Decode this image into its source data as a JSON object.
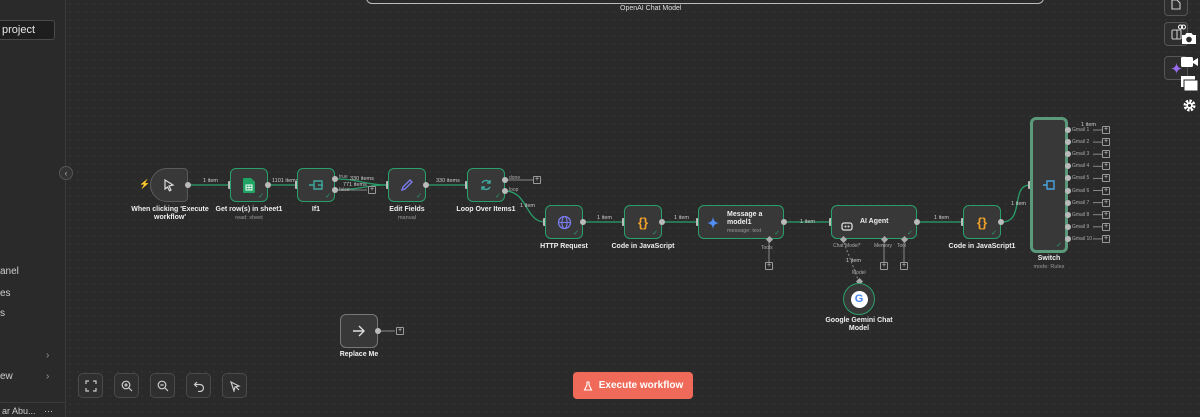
{
  "sidebar": {
    "project": "project",
    "items": [
      "anel",
      "es",
      "s",
      "",
      "ew"
    ],
    "user": "ar Abu...",
    "user_menu": "···",
    "collapse": "‹"
  },
  "canvas": {
    "top_node_label": "OpenAI Chat Model",
    "execute_button": "Execute workflow"
  },
  "nodes": {
    "trigger": {
      "label": "When clicking 'Execute workflow'"
    },
    "sheet": {
      "label": "Get row(s) in sheet1",
      "sub": "read: sheet"
    },
    "if": {
      "label": "If1"
    },
    "edit": {
      "label": "Edit Fields",
      "sub": "manual"
    },
    "loop": {
      "label": "Loop Over Items1"
    },
    "http": {
      "label": "HTTP Request"
    },
    "code1": {
      "label": "Code in JavaScript"
    },
    "gemini_msg": {
      "label": "Message a model1",
      "sub": "message: text"
    },
    "agent": {
      "label": "AI Agent"
    },
    "code2": {
      "label": "Code in JavaScript1"
    },
    "switch": {
      "label": "Switch",
      "sub": "mode: Rules"
    },
    "gemini_model": {
      "label": "Google Gemini Chat Model"
    },
    "replace": {
      "label": "Replace Me"
    }
  },
  "edges": {
    "e1": "1 item",
    "e2": "1101 items",
    "e3a": "330 items",
    "e3b": "771 items",
    "e4": "330 items",
    "e5": "1 item",
    "e6": "1 item",
    "e7": "1 item",
    "e8": "1 item",
    "e9": "1 item",
    "e10": "1 item",
    "e11": "1 item",
    "e12": "1 item",
    "model": "Model"
  },
  "ports": {
    "if_true": "true",
    "if_false": "false",
    "loop_done": "done",
    "loop_loop": "loop",
    "tools": "Tools",
    "agent_chat": "Chat Model*",
    "agent_memory": "Memory",
    "agent_tool": "Tool"
  },
  "switch_outputs": [
    "Gmail 1",
    "Gmail 2",
    "Gmail 3",
    "Gmail 4",
    "Gmail 5",
    "Gmail 6",
    "Gmail 7",
    "Gmail 8",
    "Gmail 9",
    "Gmail 10"
  ],
  "colors": {
    "accent": "#29a06b",
    "execute": "#ef6a58",
    "sheets": "#1fa463",
    "edit": "#7b7bf0",
    "loop": "#3fa9a0",
    "http": "#7b7bf0",
    "code": "#f2a22a",
    "switch": "#4aa3df"
  }
}
